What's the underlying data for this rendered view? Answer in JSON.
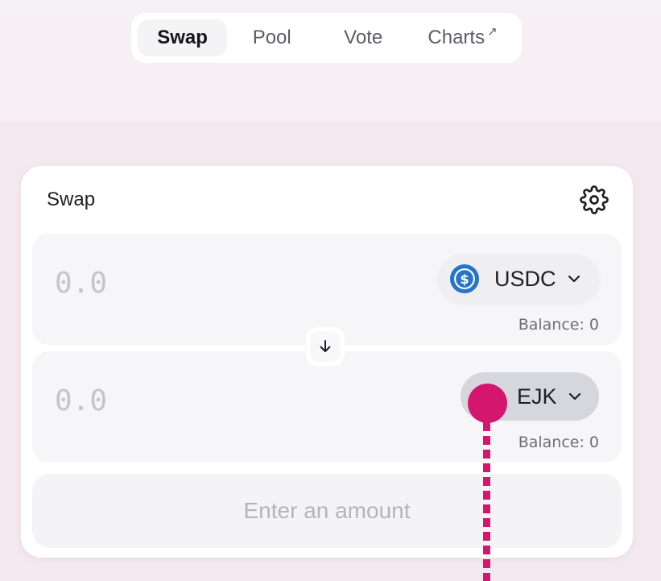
{
  "nav": {
    "items": [
      {
        "label": "Swap",
        "active": true
      },
      {
        "label": "Pool"
      },
      {
        "label": "Vote"
      },
      {
        "label": "Charts",
        "suffix_icon": "external-link-arrow"
      }
    ],
    "charts_suffix": "↗"
  },
  "swap_card": {
    "title": "Swap",
    "settings_icon": "gear-icon",
    "from": {
      "amount_placeholder": "0.0",
      "token": "USDC",
      "token_icon": "usdc-icon",
      "balance": "Balance: 0"
    },
    "to": {
      "amount_placeholder": "0.0",
      "token": "EJK",
      "balance": "Balance: 0"
    },
    "switch_icon": "arrow-down-icon",
    "action_button": "Enter an amount"
  },
  "colors": {
    "background": "#f5e9f1",
    "usdc_blue": "#2775ca",
    "marker": "#d4166e"
  }
}
